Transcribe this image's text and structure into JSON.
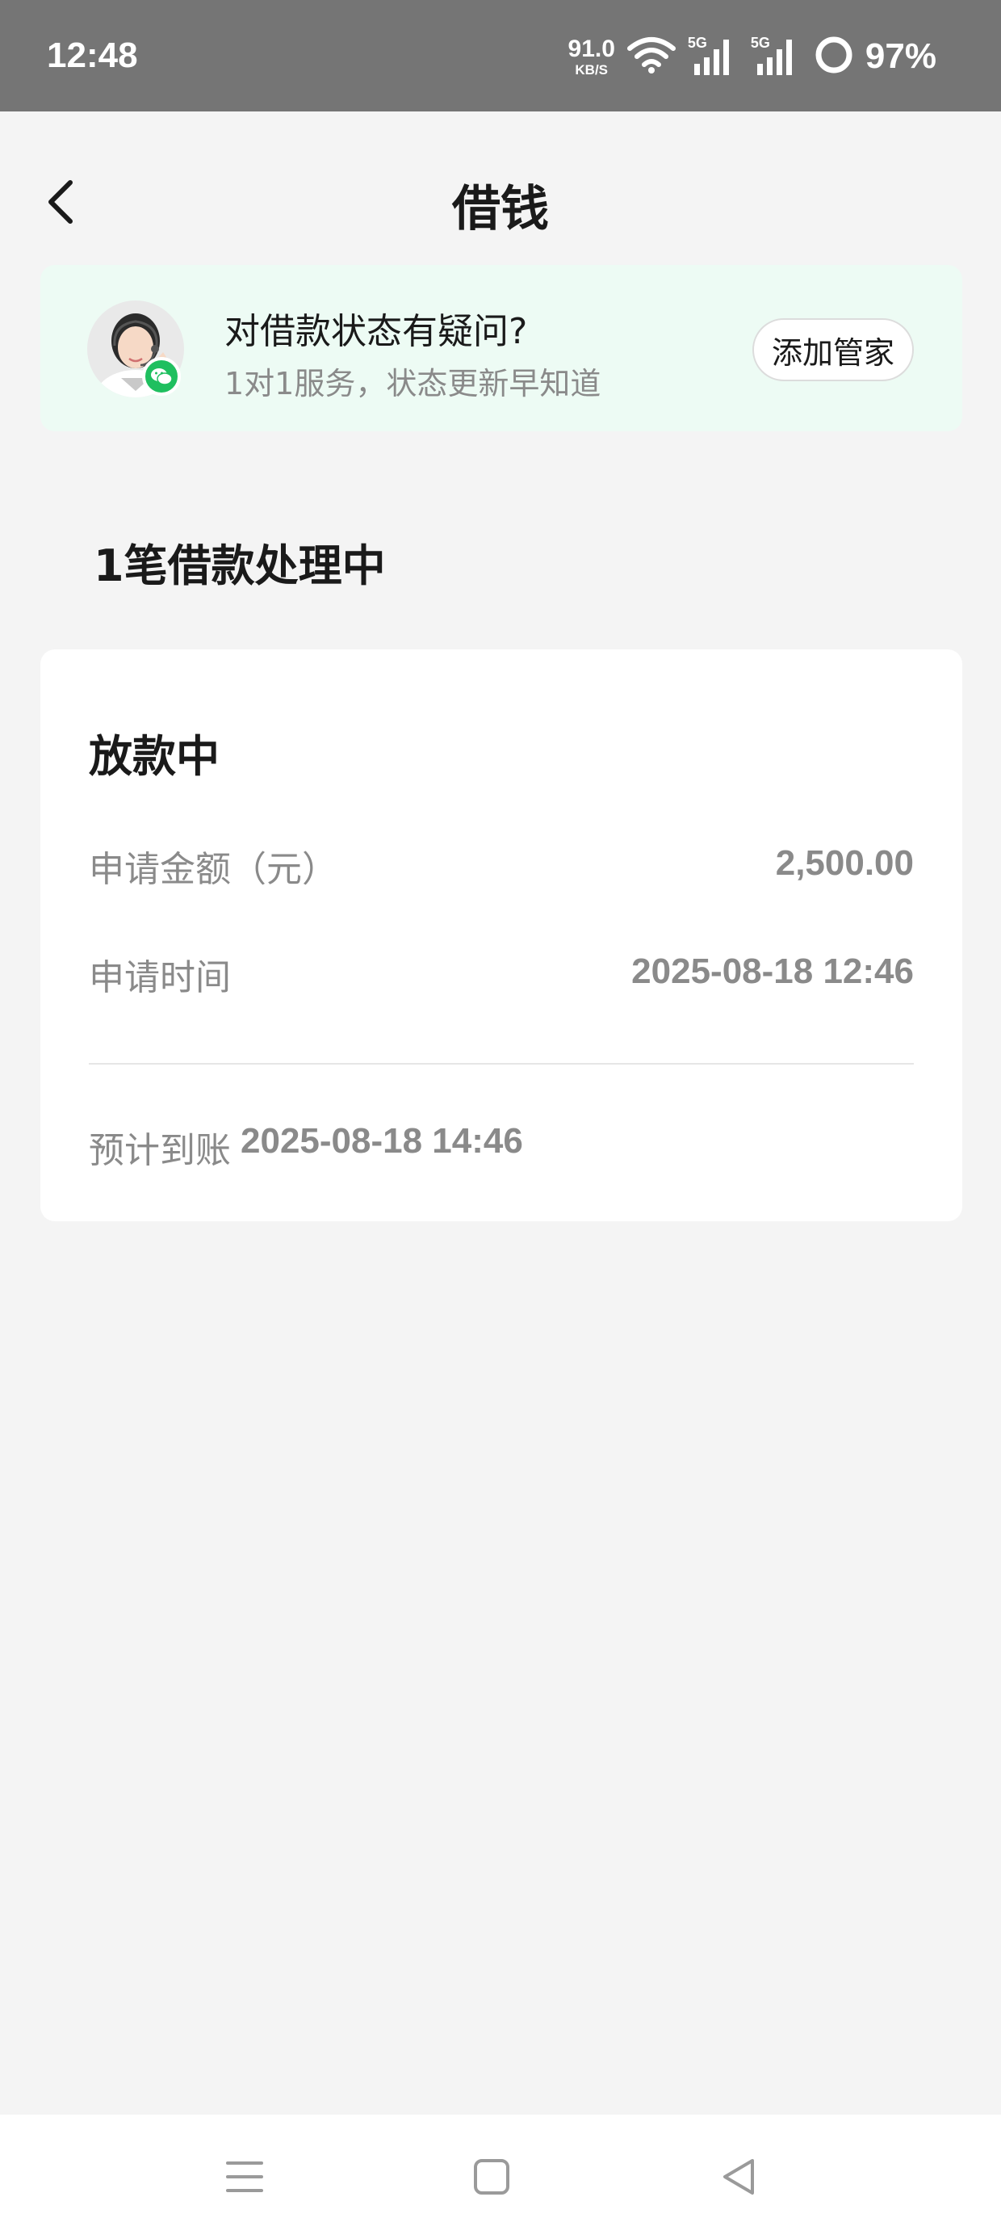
{
  "status_bar": {
    "time": "12:48",
    "net_speed_value": "91.0",
    "net_speed_unit": "KB/S",
    "signal1_label": "5G",
    "signal2_label": "5G",
    "battery_percent": "97%",
    "icons": [
      "wifi-icon",
      "signal-icon",
      "signal-icon",
      "battery-ring-icon"
    ]
  },
  "header": {
    "title": "借钱",
    "back_icon": "chevron-left-icon"
  },
  "service_banner": {
    "title": "对借款状态有疑问?",
    "subtitle": "1对1服务，状态更新早知道",
    "button_label": "添加管家",
    "avatar_icon": "customer-service-avatar",
    "badge_icon": "wechat-icon",
    "background_color": "#edfbf4",
    "badge_color": "#1fbf5f"
  },
  "section": {
    "heading": "1笔借款处理中"
  },
  "loan_card": {
    "status": "放款中",
    "rows": [
      {
        "label": "申请金额（元）",
        "value": "2,500.00"
      },
      {
        "label": "申请时间",
        "value": "2025-08-18 12:46"
      }
    ],
    "arrival_label": "预计到账",
    "arrival_time": "2025-08-18 14:46"
  },
  "system_nav": {
    "icons": [
      "menu-icon",
      "home-square-icon",
      "back-triangle-icon"
    ]
  }
}
